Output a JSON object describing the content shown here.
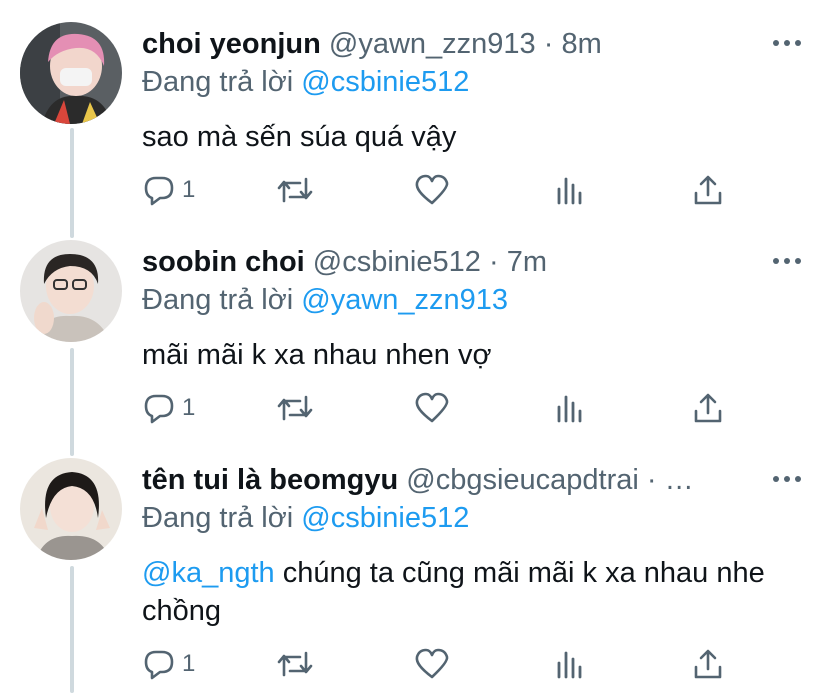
{
  "replying_prefix": "Đang trả lời",
  "tweets": [
    {
      "name": "choi yeonjun",
      "handle": "@yawn_zzn913",
      "separator": "·",
      "time": "8m",
      "reply_to": "@csbinie512",
      "text_mention": "",
      "text": "sao mà sến súa quá vậy",
      "reply_count": "1"
    },
    {
      "name": "soobin choi",
      "handle": "@csbinie512",
      "separator": "·",
      "time": "7m",
      "reply_to": "@yawn_zzn913",
      "text_mention": "",
      "text": "mãi mãi k xa nhau nhen vợ",
      "reply_count": "1"
    },
    {
      "name": "tên tui là beomgyu",
      "handle": "@cbgsieucapdtrai",
      "separator": "·",
      "time": "…",
      "reply_to": "@csbinie512",
      "text_mention": "@ka_ngth",
      "text": "chúng ta cũng mãi mãi k xa nhau nhe chồng",
      "reply_count": "1"
    }
  ],
  "icons": {
    "more": "more-horizontal-icon",
    "reply": "reply-icon",
    "retweet": "retweet-icon",
    "like": "heart-icon",
    "views": "analytics-icon",
    "share": "share-icon"
  },
  "colors": {
    "text": "#0f1419",
    "secondary": "#536471",
    "link": "#1d9bf0",
    "thread_line": "#cfd9de"
  }
}
